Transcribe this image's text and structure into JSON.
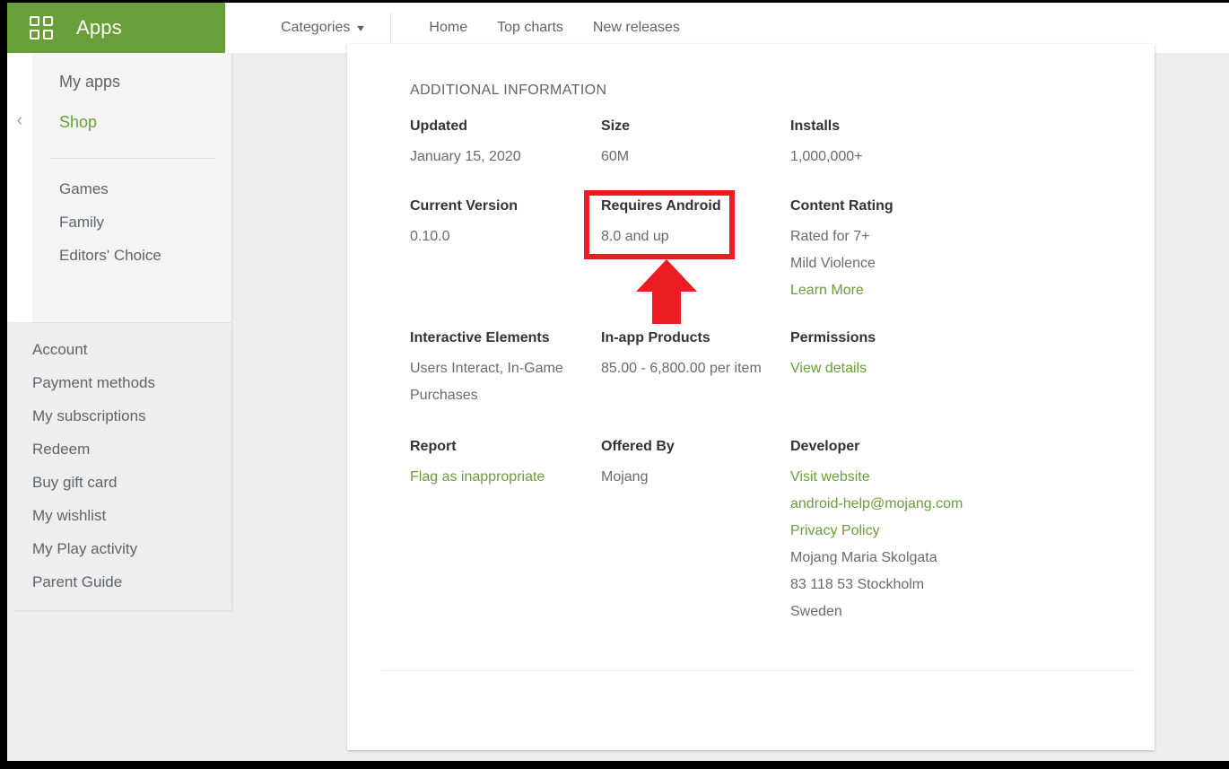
{
  "topbar": {
    "brand": "Apps",
    "apps_grid_icon": "apps-grid-icon",
    "categories_label": "Categories",
    "categories_caret": "▾",
    "nav_links": [
      "Home",
      "Top charts",
      "New releases"
    ]
  },
  "sidebar": {
    "collapse_icon": "‹",
    "top_items": [
      {
        "label": "My apps",
        "active": false
      },
      {
        "label": "Shop",
        "active": true
      },
      {
        "label": "Games",
        "active": false
      },
      {
        "label": "Family",
        "active": false
      },
      {
        "label": "Editors' Choice",
        "active": false
      }
    ],
    "bottom_items": [
      "Account",
      "Payment methods",
      "My subscriptions",
      "Redeem",
      "Buy gift card",
      "My wishlist",
      "My Play activity",
      "Parent Guide"
    ]
  },
  "main": {
    "section_title": "ADDITIONAL INFORMATION",
    "info": {
      "updated": {
        "label": "Updated",
        "value": "January 15, 2020"
      },
      "size": {
        "label": "Size",
        "value": "60M"
      },
      "installs": {
        "label": "Installs",
        "value": "1,000,000+"
      },
      "current_version": {
        "label": "Current Version",
        "value": "0.10.0"
      },
      "requires_android": {
        "label": "Requires Android",
        "value": "8.0 and up"
      },
      "content_rating": {
        "label": "Content Rating",
        "value_line1": "Rated for 7+",
        "value_line2": "Mild Violence",
        "link": "Learn More"
      },
      "interactive_elements": {
        "label": "Interactive Elements",
        "value": "Users Interact, In-Game Purchases"
      },
      "in_app_products": {
        "label": "In-app Products",
        "value": "85.00 -  6,800.00 per item"
      },
      "permissions": {
        "label": "Permissions",
        "link": "View details"
      },
      "report": {
        "label": "Report",
        "link": "Flag as inappropriate"
      },
      "offered_by": {
        "label": "Offered By",
        "value": "Mojang"
      },
      "developer": {
        "label": "Developer",
        "website_link": "Visit website",
        "email_link": "android-help@mojang.com",
        "privacy_link": "Privacy Policy",
        "address_line1": "Mojang Maria Skolgata",
        "address_line2": "83 118 53 Stockholm",
        "address_line3": "Sweden"
      }
    }
  },
  "annotation": {
    "highlight_target": "requires-android-field",
    "color": "#ed1c24",
    "arrow_direction": "up"
  }
}
